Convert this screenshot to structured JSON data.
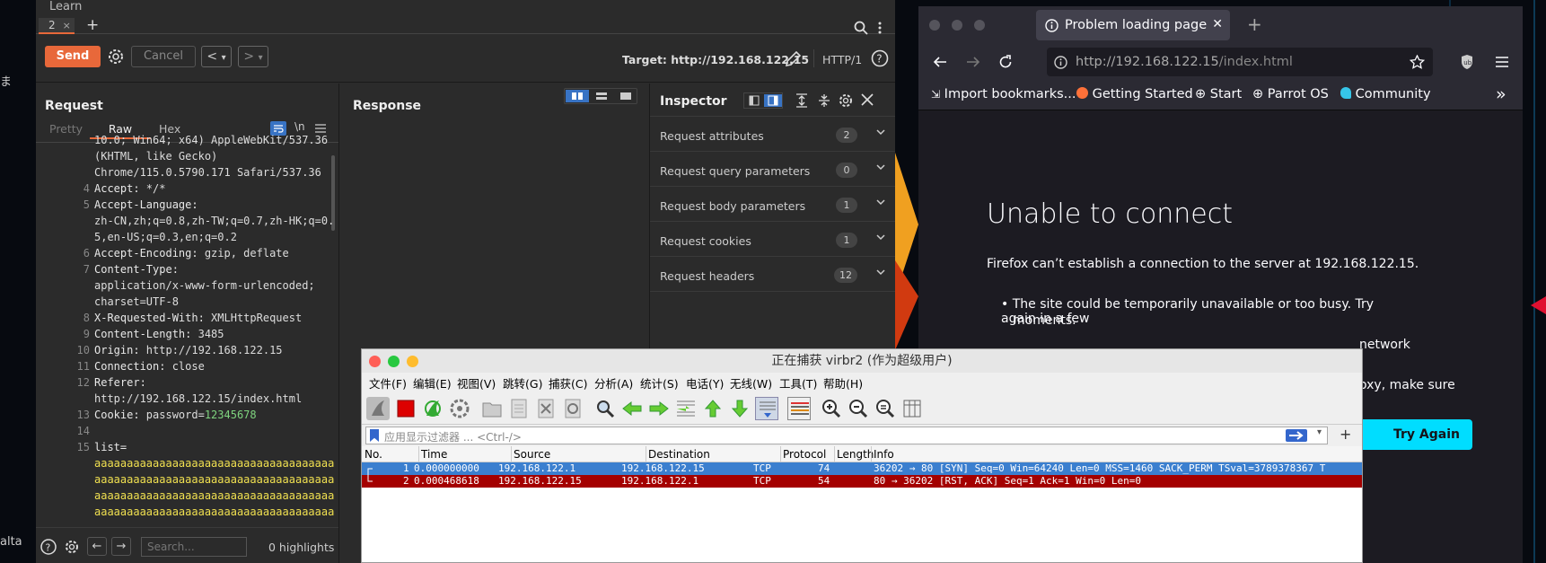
{
  "desktop": {
    "left_text_1": "ま",
    "left_text_2": "alta"
  },
  "burp": {
    "top_label": "Learn",
    "tab": {
      "label": "2",
      "close": "×"
    },
    "new_tab": "+",
    "send": "Send",
    "cancel": "Cancel",
    "prev": "<",
    "next": ">",
    "dropdown": "▾",
    "target": "Target: http://192.168.122.15",
    "http_version": "HTTP/1",
    "request": {
      "title": "Request",
      "tabs": [
        "Pretty",
        "Raw",
        "Hex"
      ],
      "active_tab": "Raw",
      "newline_toggle": "\\n",
      "lines": [
        {
          "n": "",
          "k": "",
          "v": "10.0; Win64; x64) AppleWebKit/537.36"
        },
        {
          "n": "",
          "k": "",
          "v": "(KHTML, like Gecko)"
        },
        {
          "n": "",
          "k": "",
          "v": "Chrome/115.0.5790.171 Safari/537.36"
        },
        {
          "n": "4",
          "k": "Accept:",
          "v": " */*"
        },
        {
          "n": "5",
          "k": "Accept-Language:",
          "v": ""
        },
        {
          "n": "",
          "k": "",
          "v": "zh-CN,zh;q=0.8,zh-TW;q=0.7,zh-HK;q=0."
        },
        {
          "n": "",
          "k": "",
          "v": "5,en-US;q=0.3,en;q=0.2"
        },
        {
          "n": "6",
          "k": "Accept-Encoding:",
          "v": " gzip, deflate"
        },
        {
          "n": "7",
          "k": "Content-Type:",
          "v": ""
        },
        {
          "n": "",
          "k": "",
          "v": "application/x-www-form-urlencoded;"
        },
        {
          "n": "",
          "k": "",
          "v": "charset=UTF-8"
        },
        {
          "n": "8",
          "k": "X-Requested-With:",
          "v": " XMLHttpRequest"
        },
        {
          "n": "9",
          "k": "Content-Length:",
          "v": " 3485"
        },
        {
          "n": "10",
          "k": "Origin:",
          "v": " http://192.168.122.15"
        },
        {
          "n": "11",
          "k": "Connection:",
          "v": " close"
        },
        {
          "n": "12",
          "k": "Referer:",
          "v": ""
        },
        {
          "n": "",
          "k": "",
          "v": "http://192.168.122.15/index.html"
        },
        {
          "n": "13",
          "k": "Cookie:",
          "v": " password=",
          "g": "12345678"
        },
        {
          "n": "14",
          "k": "",
          "v": ""
        },
        {
          "n": "15",
          "k": "list=",
          "v": ""
        },
        {
          "n": "",
          "k": "",
          "y": "aaaaaaaaaaaaaaaaaaaaaaaaaaaaaaaaaaaaa"
        },
        {
          "n": "",
          "k": "",
          "y": "aaaaaaaaaaaaaaaaaaaaaaaaaaaaaaaaaaaaa"
        },
        {
          "n": "",
          "k": "",
          "y": "aaaaaaaaaaaaaaaaaaaaaaaaaaaaaaaaaaaaa"
        },
        {
          "n": "",
          "k": "",
          "y": "aaaaaaaaaaaaaaaaaaaaaaaaaaaaaaaaaaaaa"
        }
      ],
      "search_placeholder": "Search...",
      "highlights": "0 highlights"
    },
    "response": {
      "title": "Response"
    },
    "inspector": {
      "title": "Inspector",
      "rows": [
        {
          "label": "Request attributes",
          "count": "2"
        },
        {
          "label": "Request query parameters",
          "count": "0"
        },
        {
          "label": "Request body parameters",
          "count": "1"
        },
        {
          "label": "Request cookies",
          "count": "1"
        },
        {
          "label": "Request headers",
          "count": "12"
        }
      ]
    }
  },
  "firefox": {
    "tab_title": "Problem loading page",
    "tab_close": "✕",
    "new_tab": "+",
    "url_host": "http://192.168.122.15",
    "url_path": "/index.html",
    "bookmarks": [
      "Import bookmarks...",
      "Getting Started",
      "Start",
      "Parrot OS",
      "Community"
    ],
    "more": "»",
    "error_title": "Unable to connect",
    "error_desc": "Firefox can’t establish a connection to the server at 192.168.122.15.",
    "bullet_1a": "The site could be temporarily unavailable or too busy. Try again in a few",
    "bullet_1b": "moments.",
    "bullet_2_tail": "network",
    "bullet_3_tail": "oxy, make sure",
    "try_again": "Try Again"
  },
  "wireshark": {
    "title": "正在捕获 virbr2 (作为超级用户)",
    "menu": [
      "文件(F)",
      "编辑(E)",
      "视图(V)",
      "跳转(G)",
      "捕获(C)",
      "分析(A)",
      "统计(S)",
      "电话(Y)",
      "无线(W)",
      "工具(T)",
      "帮助(H)"
    ],
    "filter_placeholder": "应用显示过滤器 ... <Ctrl-/>",
    "filter_add": "+",
    "columns": [
      "No.",
      "Time",
      "Source",
      "Destination",
      "Protocol",
      "Length",
      "Info"
    ],
    "packets": [
      {
        "no": "1",
        "time": "0.000000000",
        "src": "192.168.122.1",
        "dst": "192.168.122.15",
        "proto": "TCP",
        "len": "74",
        "info": "36202 → 80 [SYN] Seq=0 Win=64240 Len=0 MSS=1460 SACK_PERM TSval=3789378367 T"
      },
      {
        "no": "2",
        "time": "0.000468618",
        "src": "192.168.122.15",
        "dst": "192.168.122.1",
        "proto": "TCP",
        "len": "54",
        "info": "80 → 36202 [RST, ACK] Seq=1 Ack=1 Win=0 Len=0"
      }
    ]
  }
}
